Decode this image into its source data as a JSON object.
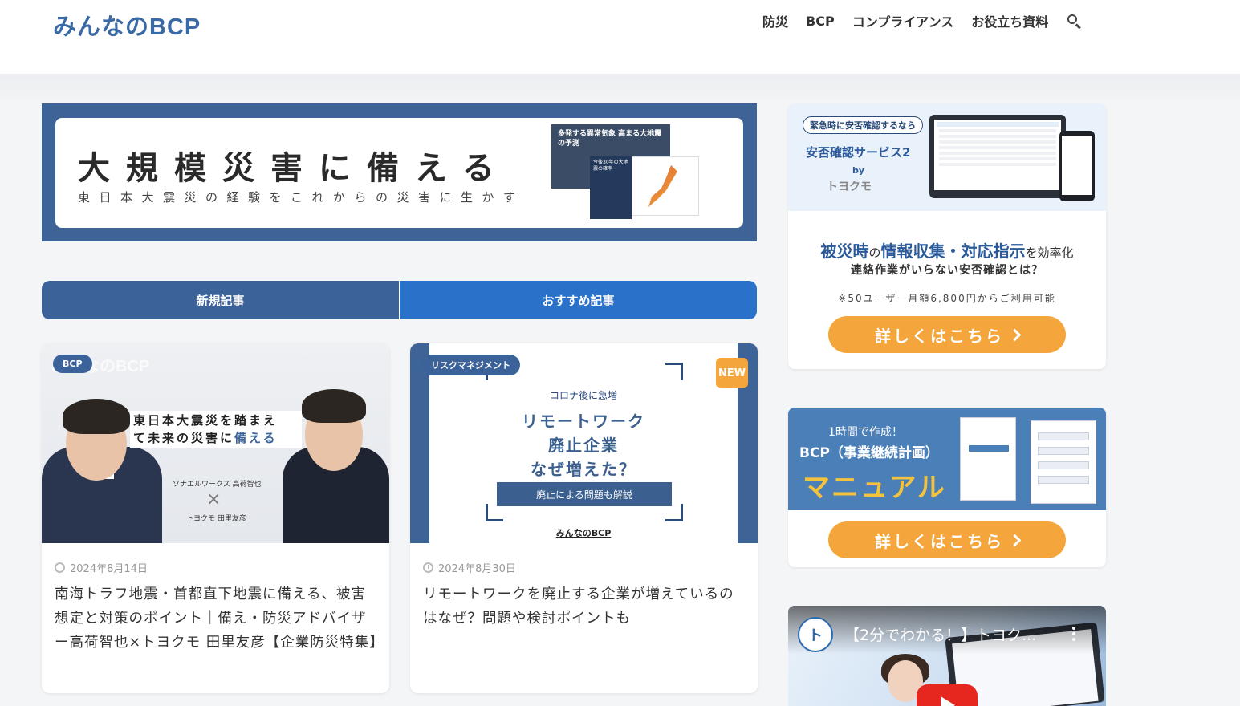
{
  "header": {
    "logo": "みんなのBCP",
    "nav": [
      "防災",
      "BCP",
      "コンプライアンス",
      "お役立ち資料"
    ],
    "search_icon": "search-icon"
  },
  "hero": {
    "title": "大規模災害に備える",
    "subtitle": "東日本大震災の経験をこれからの災害に生かす",
    "book_text": "多発する異常気象 高まる大地震の予測",
    "book2_text": "今後30年の大地震の確率"
  },
  "tabs": [
    "新規記事",
    "おすすめ記事"
  ],
  "cards": [
    {
      "category": "BCP",
      "date_icon": "refresh-icon",
      "date": "2024年8月14日",
      "title": "南海トラフ地震・首都直下地震に備える、被害想定と対策のポイント｜備え・防災アドバイザー高荷智也×トヨクモ 田里友彦【企業防災特集】",
      "thumb": {
        "bg_logo": "みんなのBCP",
        "quote_line1": "東日本大震災を踏まえ",
        "quote_line2_a": "て未来の災害に",
        "quote_line2_b": "備える",
        "speaker1": "ソナエルワークス 高荷智也",
        "x_mark": "×",
        "speaker2": "トヨクモ 田里友彦"
      }
    },
    {
      "category": "リスクマネジメント",
      "badge": "NEW",
      "date_icon": "clock-icon",
      "date": "2024年8月30日",
      "title": "リモートワークを廃止する企業が増えているのはなぜ？問題や検討ポイントも",
      "thumb": {
        "pre": "コロナ後に急増",
        "line1": "リモートワーク",
        "line2": "廃止企業",
        "line3": "なぜ増えた？",
        "bar": "廃止による問題も解説",
        "logo": "みんなのBCP"
      }
    }
  ],
  "sidebar": {
    "ad1": {
      "pill": "緊急時に安否確認するなら",
      "service": "安否確認サービス2",
      "by": "by",
      "brand": "トヨクモ",
      "headline_a": "被災時",
      "headline_b": "の",
      "headline_c": "情報収集・対応指示",
      "headline_d": "を効率化",
      "sub": "連絡作業がいらない安否確認とは？",
      "price": "※50ユーザー月額6,800円からご利用可能",
      "cta": "詳しくはこちら"
    },
    "ad2": {
      "pre": "1時間で作成！",
      "mid": "BCP（事業継続計画）",
      "big": "マニュアル",
      "cta": "詳しくはこちら"
    },
    "video": {
      "channel": "ト",
      "title": "【2分でわかる！】トヨク..."
    }
  },
  "colors": {
    "brand": "#3a6aa6",
    "tab_new": "#3b6299",
    "tab_reco": "#2a72c9",
    "cta": "#f4a53c",
    "badge": "#f4a53c"
  }
}
